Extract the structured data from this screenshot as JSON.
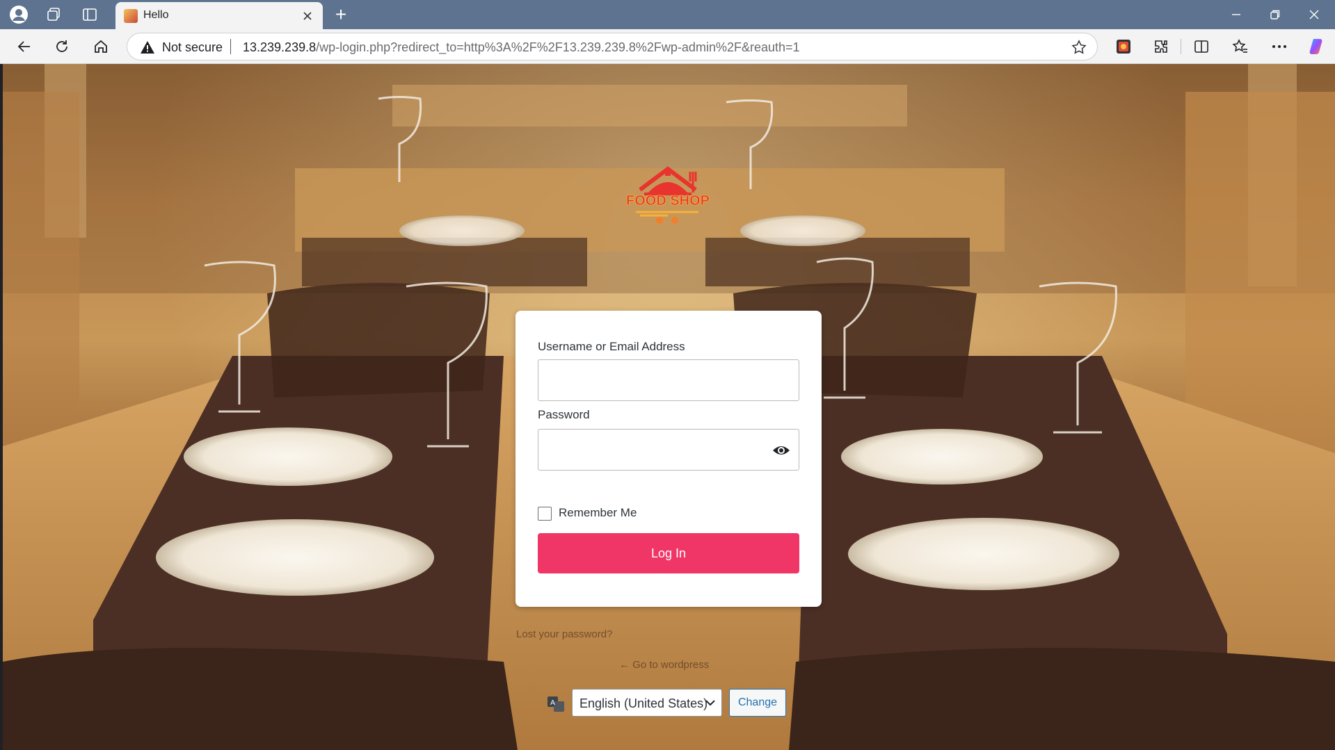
{
  "browser": {
    "tab_title": "Hello",
    "security_label": "Not secure",
    "url_host": "13.239.239.8",
    "url_path": "/wp-login.php?redirect_to=http%3A%2F%2F13.239.239.8%2Fwp-admin%2F&reauth=1"
  },
  "login": {
    "username_label": "Username or Email Address",
    "password_label": "Password",
    "remember_label": "Remember Me",
    "login_button": "Log In",
    "lost_password": "Lost your password?",
    "back_link": "← Go to wordpress"
  },
  "language": {
    "selected": "English (United States)",
    "change_button": "Change"
  },
  "logo": {
    "text": "FOOD SHOP"
  },
  "colors": {
    "tabbar": "#5d738f",
    "primary_button": "#f03667",
    "change_button": "#2271b1"
  }
}
